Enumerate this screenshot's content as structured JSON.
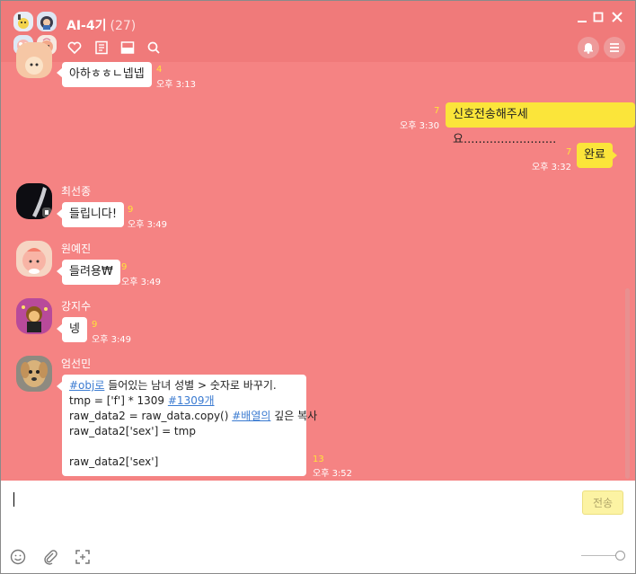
{
  "window": {
    "title": "AI-4기",
    "member_count": "(27)"
  },
  "messages": [
    {
      "text": "아하ㅎㅎㄴ넵넵",
      "unread": "4",
      "time": "오후 3:13"
    },
    {
      "text": "신호전송해주세요.........................",
      "unread": "7",
      "time": "오후 3:30"
    },
    {
      "text": "완료",
      "unread": "7",
      "time": "오후 3:32"
    },
    {
      "sender": "최선종",
      "text": "들립니다!",
      "unread": "9",
      "time": "오후 3:49"
    },
    {
      "sender": "원예진",
      "text": "들려용₩",
      "unread": "9",
      "time": "오후 3:49"
    },
    {
      "sender": "강지수",
      "text": "넹",
      "unread": "9",
      "time": "오후 3:49"
    },
    {
      "sender": "엄선민",
      "unread": "13",
      "time": "오후 3:52",
      "lines": {
        "l1_link": "#obj로",
        "l1_rest": " 들어있는 남녀 성별 > 숫자로 바꾸기.",
        "l2_text": "tmp = ['f'] * 1309 ",
        "l2_link": "#1309개",
        "l3_text": "raw_data2 = raw_data.copy() ",
        "l3_link": "#배열의",
        "l3_rest": " 깊은 복사",
        "l4": "raw_data2['sex'] = tmp",
        "l6": "raw_data2['sex']"
      }
    }
  ],
  "composer": {
    "send_label": "전송"
  },
  "colors": {
    "chat_bg": "#f58383",
    "header_bg": "#f07a7a",
    "my_bubble": "#fbe53a",
    "unread": "#ffe33a",
    "link": "#3b7bd1"
  },
  "icons": {
    "header": [
      "heart-icon",
      "notes-icon",
      "album-icon",
      "search-icon",
      "bell-icon",
      "menu-icon"
    ],
    "window": [
      "minimize-icon",
      "maximize-icon",
      "close-icon"
    ],
    "composer": [
      "emoticon-icon",
      "attach-icon",
      "capture-icon"
    ]
  }
}
